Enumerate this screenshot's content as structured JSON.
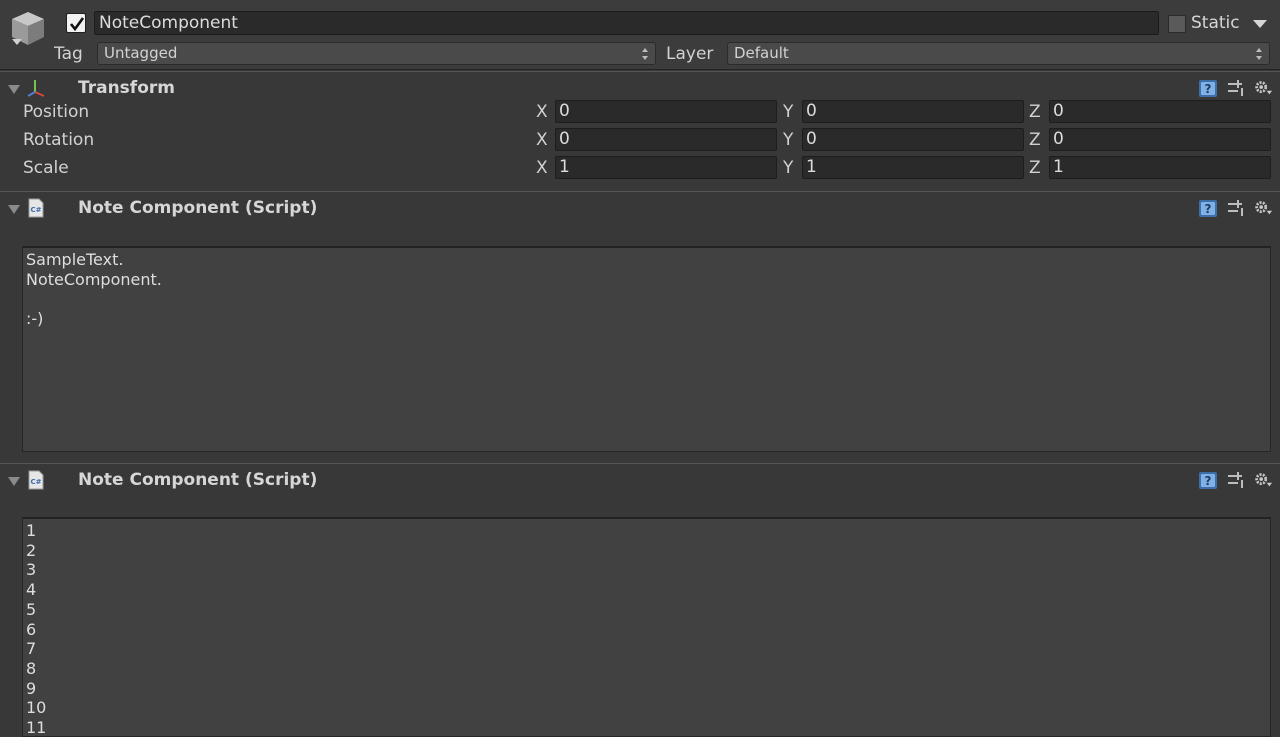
{
  "game_object": {
    "name": "NoteComponent",
    "active": true,
    "static_label": "Static",
    "static_checked": false,
    "tag_label": "Tag",
    "tag_value": "Untagged",
    "layer_label": "Layer",
    "layer_value": "Default",
    "icon": "cube-icon"
  },
  "transform": {
    "title": "Transform",
    "icon": "transform-axes-icon",
    "rows": [
      {
        "label": "Position",
        "x": "0",
        "y": "0",
        "z": "0"
      },
      {
        "label": "Rotation",
        "x": "0",
        "y": "0",
        "z": "0"
      },
      {
        "label": "Scale",
        "x": "1",
        "y": "1",
        "z": "1"
      }
    ],
    "axis_labels": {
      "x": "X",
      "y": "Y",
      "z": "Z"
    }
  },
  "components": [
    {
      "title": "Note Component (Script)",
      "icon": "csharp-script-icon",
      "note_lines": [
        "SampleText.",
        "NoteComponent.",
        "",
        ":-)"
      ]
    },
    {
      "title": "Note Component (Script)",
      "icon": "csharp-script-icon",
      "note_lines": [
        "1",
        "2",
        "3",
        "4",
        "5",
        "6",
        "7",
        "8",
        "9",
        "10",
        "11"
      ]
    }
  ],
  "header_icons": [
    "help-icon",
    "preset-icon",
    "gear-icon"
  ],
  "colors": {
    "background": "#383838",
    "field": "#2a2a2a",
    "text_area": "#414141",
    "help_blue": "#6aa0d8"
  }
}
